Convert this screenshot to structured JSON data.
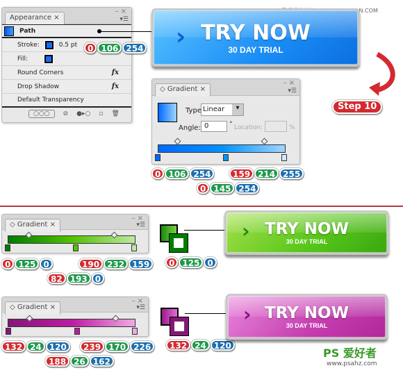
{
  "appearance": {
    "tab": "Appearance",
    "close": "×",
    "item": "Path",
    "rows": {
      "stroke": "Stroke:",
      "stroke_weight": "0.5 pt",
      "fill": "Fill:",
      "round": "Round Corners",
      "shadow": "Drop Shadow",
      "transparency": "Default Transparency"
    },
    "fx": "fx"
  },
  "gradient_panel": {
    "tab": "Gradient",
    "type_label": "Type:",
    "type_value": "Linear",
    "angle_label": "Angle:",
    "angle_value": "0",
    "degree": "°",
    "location_label": "Location:",
    "location_value": "",
    "percent": "%"
  },
  "buttons": {
    "title": "TRY NOW",
    "subtitle": "30 DAY TRIAL",
    "colors": {
      "blue": "#1a8cf5",
      "green": "#56c41a",
      "purple": "#c43cae"
    }
  },
  "step": "Step 10",
  "watermark_top": "思缘设计论坛 WWW.MISSYUAN.COM",
  "watermark_bottom": {
    "logo": "PS 爱好者",
    "url": "www.psahz.com"
  },
  "badges": {
    "stroke": [
      "0",
      "106",
      "254"
    ],
    "blue_left": [
      "0",
      "106",
      "254"
    ],
    "blue_right": [
      "159",
      "214",
      "255"
    ],
    "blue_mid": [
      "0",
      "145",
      "254"
    ],
    "green_left": [
      "0",
      "125",
      "0"
    ],
    "green_right": [
      "190",
      "232",
      "159"
    ],
    "green_mid": [
      "82",
      "193",
      "0"
    ],
    "green_swatch": [
      "0",
      "125",
      "0"
    ],
    "purple_left": [
      "132",
      "24",
      "120"
    ],
    "purple_right": [
      "239",
      "170",
      "226"
    ],
    "purple_mid": [
      "188",
      "26",
      "162"
    ],
    "purple_swatch": [
      "132",
      "24",
      "120"
    ]
  }
}
